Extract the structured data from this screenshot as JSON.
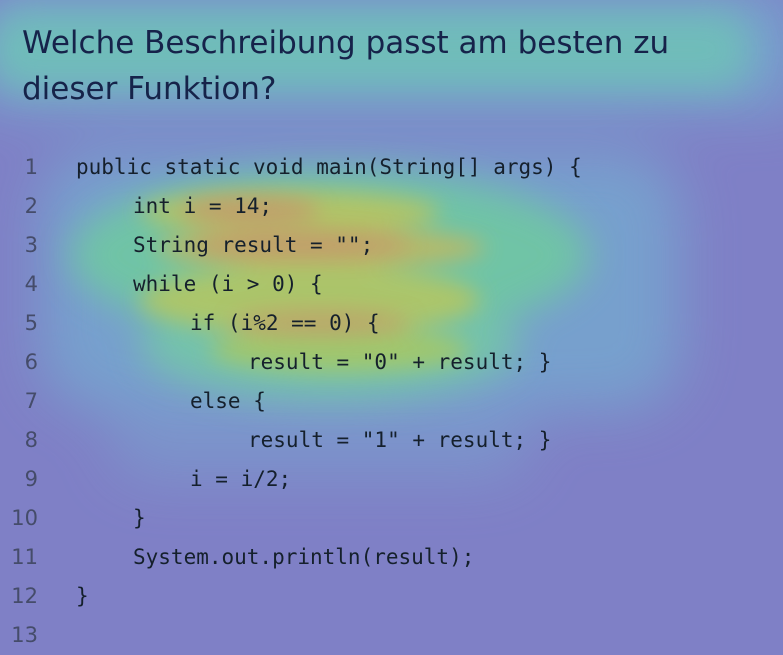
{
  "question": "Welche Beschreibung passt am besten zu dieser Funktion?",
  "colors": {
    "background": "#7f80c6",
    "heat_low": "#76a6cf",
    "heat_mid": "#70c8a2",
    "heat_high": "#bcc45d",
    "heat_peak": "#c88f6d",
    "text": "#15202c"
  },
  "code": [
    {
      "number": "1",
      "text": "public static void main(String[] args) {"
    },
    {
      "number": "2",
      "text": "int i = 14;"
    },
    {
      "number": "3",
      "text": "String result = \"\";"
    },
    {
      "number": "4",
      "text": "while (i > 0) {"
    },
    {
      "number": "5",
      "text": "if (i%2 == 0) {"
    },
    {
      "number": "6",
      "text": "result = \"0\" + result; }"
    },
    {
      "number": "7",
      "text": "else {"
    },
    {
      "number": "8",
      "text": "result = \"1\" + result; }"
    },
    {
      "number": "9",
      "text": "i = i/2;"
    },
    {
      "number": "10",
      "text": "}"
    },
    {
      "number": "11",
      "text": "System.out.println(result);"
    },
    {
      "number": "12",
      "text": "}"
    },
    {
      "number": "13",
      "text": ""
    }
  ]
}
